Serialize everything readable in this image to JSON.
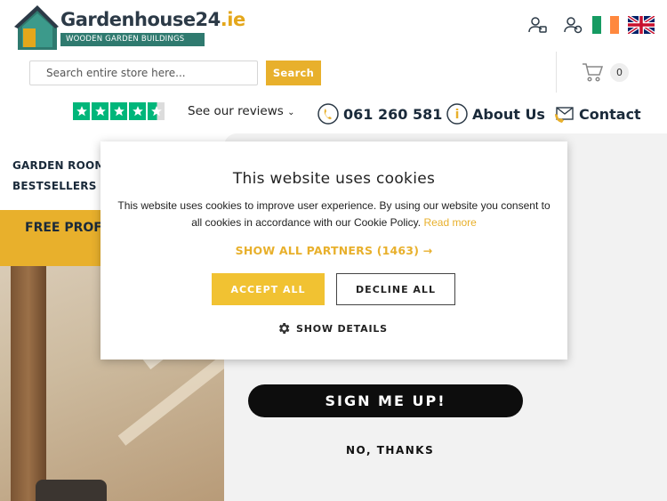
{
  "logo": {
    "name_main": "Gardenhouse24",
    "name_tld": ".ie",
    "tagline": "WOODEN GARDEN BUILDINGS"
  },
  "header": {
    "icons": [
      "user-login-icon",
      "user-register-icon",
      "ireland-flag-icon",
      "uk-flag-icon"
    ],
    "search": {
      "placeholder": "Search entire store here...",
      "button_label": "Search"
    },
    "cart": {
      "count": "0"
    }
  },
  "trust": {
    "reviews_label": "See our reviews",
    "stars": 4.5
  },
  "contacts": {
    "phone": "061 260 581",
    "about": "About Us",
    "contact": "Contact"
  },
  "page": {
    "nav": [
      "GARDEN ROOM",
      "BESTSELLERS"
    ],
    "banner_text": "FREE PROFE",
    "newsletter": {
      "signup_label": "SIGN ME UP!",
      "decline_label": "NO, THANKS"
    }
  },
  "cookie": {
    "title": "This website uses cookies",
    "body": "This website uses cookies to improve user experience. By using our website you consent to all cookies in accordance with our Cookie Policy.",
    "read_more": "Read more",
    "partners": "SHOW ALL PARTNERS (1463) →",
    "accept": "ACCEPT ALL",
    "decline": "DECLINE ALL",
    "details": "SHOW DETAILS"
  },
  "colors": {
    "accent_yellow": "#e8b02c",
    "brand_teal": "#2f7a6f",
    "trustpilot_green": "#00b67a",
    "dark_navy": "#1a2a3a"
  }
}
